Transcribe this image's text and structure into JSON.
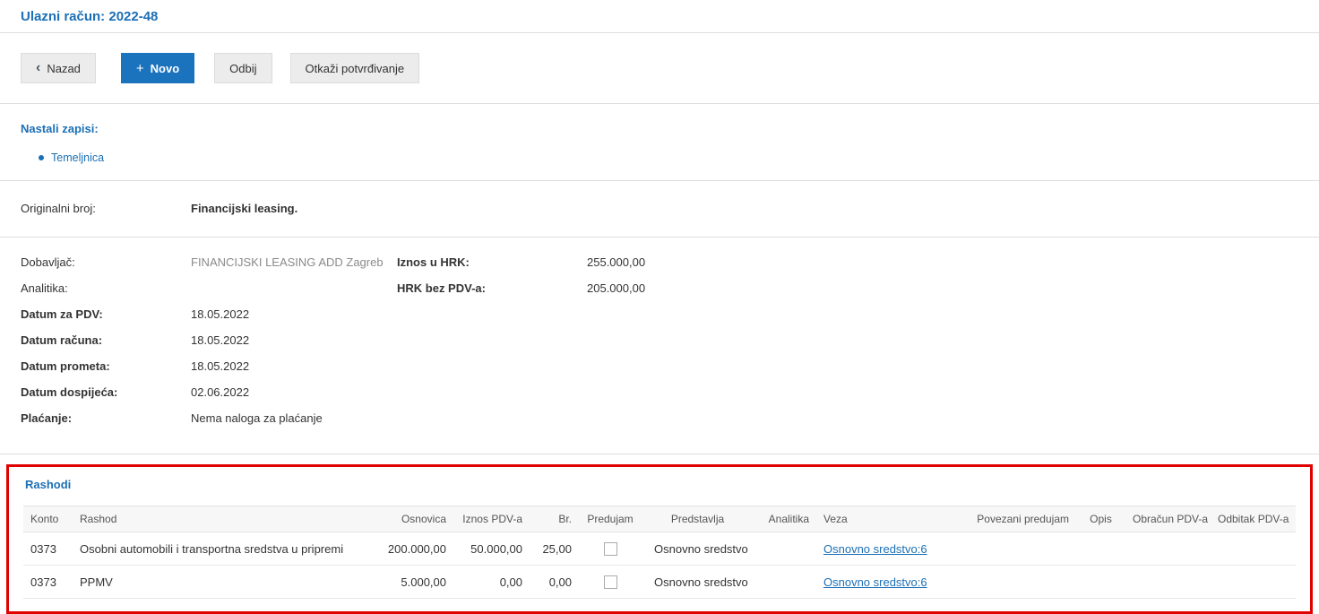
{
  "page": {
    "title": "Ulazni račun: 2022-48"
  },
  "colors": {
    "accent_blue": "#1b72bd",
    "heading_blue": "#1b6fb5",
    "link_blue": "#1b6fb5",
    "highlight_red": "#e10000"
  },
  "icons": {
    "back_chevron": "‹",
    "plus": "+"
  },
  "toolbar": {
    "back_label": "Nazad",
    "new_label": "Novo",
    "reject_label": "Odbij",
    "cancel_confirm_label": "Otkaži potvrđivanje"
  },
  "records": {
    "heading": "Nastali zapisi:",
    "items": [
      {
        "label": "Temeljnica"
      }
    ]
  },
  "original_number": {
    "label": "Originalni broj:",
    "value": "Financijski leasing."
  },
  "details_left": [
    {
      "label": "Dobavljač:",
      "value": "FINANCIJSKI LEASING ADD Zagreb"
    },
    {
      "label": "Analitika:",
      "value": ""
    },
    {
      "label": "Datum za PDV:",
      "value": "18.05.2022"
    },
    {
      "label": "Datum računa:",
      "value": "18.05.2022"
    },
    {
      "label": "Datum prometa:",
      "value": "18.05.2022"
    },
    {
      "label": "Datum dospijeća:",
      "value": "02.06.2022"
    },
    {
      "label": "Plaćanje:",
      "value": "Nema naloga za plaćanje"
    }
  ],
  "details_right": [
    {
      "label": "Iznos u HRK:",
      "value": "255.000,00"
    },
    {
      "label": "HRK bez PDV-a:",
      "value": "205.000,00"
    }
  ],
  "expenses": {
    "heading": "Rashodi",
    "columns": {
      "konto": "Konto",
      "rashod": "Rashod",
      "osnovica": "Osnovica",
      "iznos_pdv": "Iznos PDV-a",
      "br": "Br.",
      "predujam": "Predujam",
      "predstavlja": "Predstavlja",
      "analitika": "Analitika",
      "veza": "Veza",
      "povezani_predujam": "Povezani predujam",
      "opis": "Opis",
      "obracun_pdv": "Obračun PDV-a",
      "odbitak_pdv": "Odbitak PDV-a"
    },
    "rows": [
      {
        "konto": "0373",
        "rashod": "Osobni automobili i transportna sredstva u pripremi",
        "osnovica": "200.000,00",
        "iznos_pdv": "50.000,00",
        "br": "25,00",
        "predujam_checked": false,
        "predstavlja": "Osnovno sredstvo",
        "analitika": "",
        "veza": "Osnovno sredstvo:6",
        "povezani_predujam": "",
        "opis": "",
        "obracun_pdv": "",
        "odbitak_pdv": ""
      },
      {
        "konto": "0373",
        "rashod": "PPMV",
        "osnovica": "5.000,00",
        "iznos_pdv": "0,00",
        "br": "0,00",
        "predujam_checked": false,
        "predstavlja": "Osnovno sredstvo",
        "analitika": "",
        "veza": "Osnovno sredstvo:6",
        "povezani_predujam": "",
        "opis": "",
        "obracun_pdv": "",
        "odbitak_pdv": ""
      }
    ]
  }
}
